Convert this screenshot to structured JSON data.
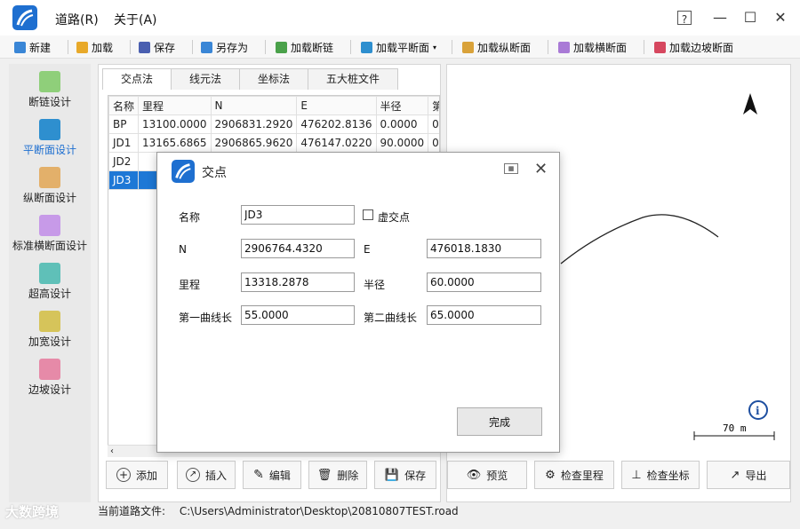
{
  "app": {
    "menus": [
      "道路(R)",
      "关于(A)"
    ],
    "window_buttons": [
      "?",
      "—",
      "☐",
      "✕"
    ]
  },
  "toolbar": {
    "items": [
      {
        "label": "新建",
        "icon": "new-file-icon",
        "color": "#3a86d6"
      },
      {
        "label": "加载",
        "icon": "folder-icon",
        "color": "#e8a92a"
      },
      {
        "label": "保存",
        "icon": "save-icon",
        "color": "#4a5fb0"
      },
      {
        "label": "另存为",
        "icon": "save-as-icon",
        "color": "#3a86d6"
      },
      {
        "label": "加载断链",
        "icon": "chain-icon",
        "color": "#4aa14a"
      },
      {
        "label": "加载平断面",
        "icon": "plan-icon",
        "color": "#2e8fcf"
      },
      {
        "label": "加载纵断面",
        "icon": "profile-icon",
        "color": "#d9a23a"
      },
      {
        "label": "加载横断面",
        "icon": "cross-section-icon",
        "color": "#a97ad6"
      },
      {
        "label": "加载边坡断面",
        "icon": "slope-icon",
        "color": "#d6475f"
      }
    ]
  },
  "sidebar": {
    "items": [
      {
        "label": "断链设计",
        "icon": "chain-design-icon",
        "color": "#8fcf7a"
      },
      {
        "label": "平断面设计",
        "icon": "plan-design-icon",
        "color": "#2e8fcf",
        "active": true
      },
      {
        "label": "纵断面设计",
        "icon": "profile-design-icon",
        "color": "#e3b06a"
      },
      {
        "label": "标准横断面设计",
        "icon": "cross-design-icon",
        "color": "#c79ae8"
      },
      {
        "label": "超高设计",
        "icon": "superelevation-icon",
        "color": "#5fc0b8"
      },
      {
        "label": "加宽设计",
        "icon": "widening-icon",
        "color": "#d6c45a"
      },
      {
        "label": "边坡设计",
        "icon": "slope-design-icon",
        "color": "#e68aa8"
      }
    ]
  },
  "tabs": [
    "交点法",
    "线元法",
    "坐标法",
    "五大桩文件"
  ],
  "table": {
    "headers": [
      "名称",
      "里程",
      "N",
      "E",
      "半径",
      "第"
    ],
    "rows": [
      [
        "BP",
        "13100.0000",
        "2906831.2920",
        "476202.8136",
        "0.0000",
        "0"
      ],
      [
        "JD1",
        "13165.6865",
        "2906865.9620",
        "476147.0220",
        "90.0000",
        "0"
      ],
      [
        "JD2",
        "",
        "",
        "",
        "",
        ""
      ],
      [
        "JD3",
        "",
        "",
        "",
        "",
        ""
      ]
    ],
    "selected_row": 3
  },
  "actions": [
    {
      "label": "添加",
      "icon": "add-icon"
    },
    {
      "label": "插入",
      "icon": "insert-icon"
    },
    {
      "label": "编辑",
      "icon": "edit-icon"
    },
    {
      "label": "删除",
      "icon": "delete-icon"
    },
    {
      "label": "保存",
      "icon": "save-icon"
    }
  ],
  "right_actions": [
    {
      "label": "预览",
      "icon": "eye-icon"
    },
    {
      "label": "检查里程",
      "icon": "check-mileage-icon"
    },
    {
      "label": "检查坐标",
      "icon": "check-coord-icon"
    },
    {
      "label": "导出",
      "icon": "export-icon"
    }
  ],
  "preview": {
    "scale_label": "70 m",
    "north_arrow": "north-arrow-icon",
    "info_icon": "i"
  },
  "status": {
    "label": "当前道路文件:",
    "path": "C:\\Users\\Administrator\\Desktop\\20810807TEST.road"
  },
  "watermark": "大数跨境",
  "dialog": {
    "title": "交点",
    "fields": {
      "name_label": "名称",
      "name_value": "JD3",
      "virtual_label": "虚交点",
      "n_label": "N",
      "n_value": "2906764.4320",
      "e_label": "E",
      "e_value": "476018.1830",
      "mileage_label": "里程",
      "mileage_value": "13318.2878",
      "radius_label": "半径",
      "radius_value": "60.0000",
      "curve1_label": "第一曲线长",
      "curve1_value": "55.0000",
      "curve2_label": "第二曲线长",
      "curve2_value": "65.0000"
    },
    "done_label": "完成"
  }
}
